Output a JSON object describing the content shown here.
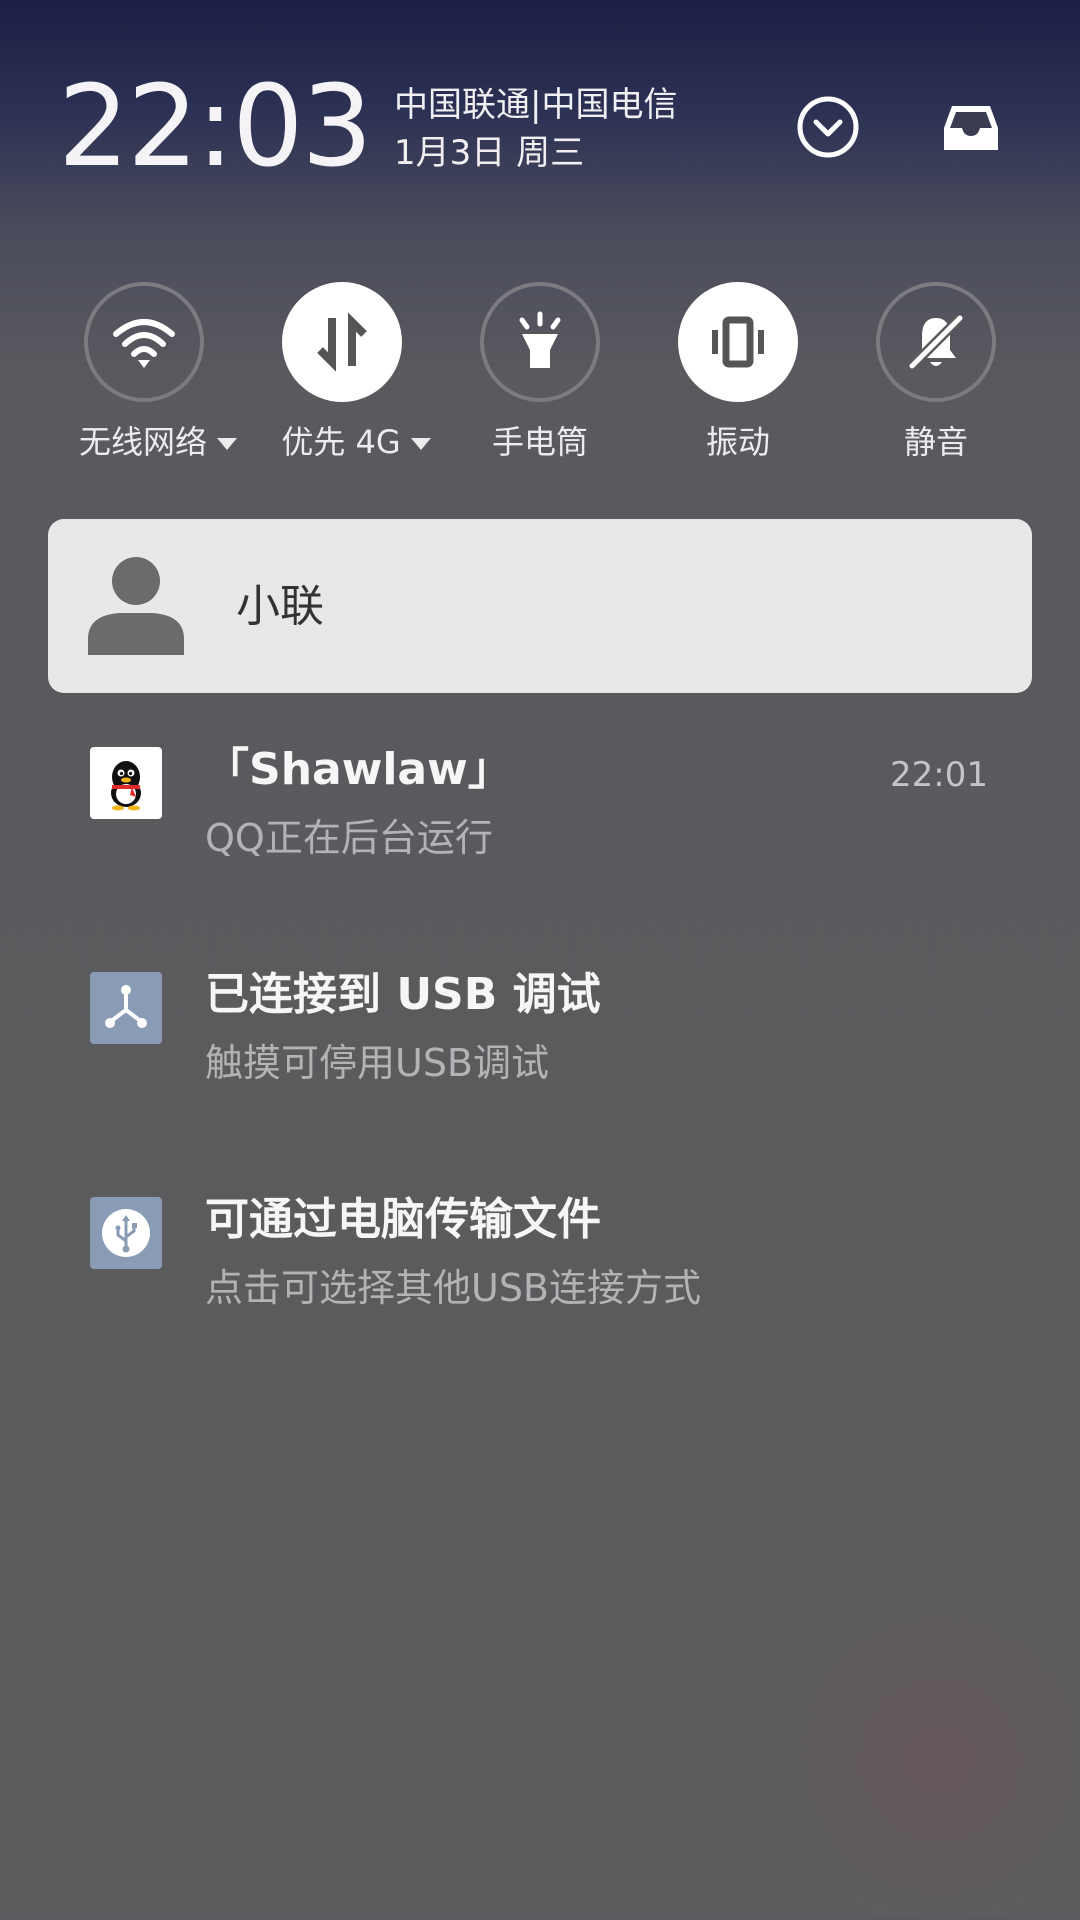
{
  "header": {
    "time": "22:03",
    "carrier": "中国联通|中国电信",
    "date": "1月3日 周三"
  },
  "quick_settings": [
    {
      "id": "wifi",
      "label": "无线网络",
      "state": "off",
      "dropdown": true,
      "icon": "wifi-icon"
    },
    {
      "id": "data",
      "label": "优先 4G",
      "state": "on",
      "dropdown": true,
      "icon": "mobile-data-icon"
    },
    {
      "id": "flashlight",
      "label": "手电筒",
      "state": "off",
      "dropdown": false,
      "icon": "flashlight-icon"
    },
    {
      "id": "vibrate",
      "label": "振动",
      "state": "on",
      "dropdown": false,
      "icon": "vibrate-icon"
    },
    {
      "id": "mute",
      "label": "静音",
      "state": "off",
      "dropdown": false,
      "icon": "bell-off-icon"
    }
  ],
  "contact": {
    "name": "小联"
  },
  "notifications": [
    {
      "icon": "qq-penguin-icon",
      "title": "「Shawlaw」",
      "text": "QQ正在后台运行",
      "time": "22:01"
    },
    {
      "icon": "usb-debug-icon",
      "title": "已连接到 USB 调试",
      "text": "触摸可停用USB调试"
    },
    {
      "icon": "usb-icon",
      "title": "可通过电脑传输文件",
      "text": "点击可选择其他USB连接方式"
    }
  ],
  "colors": {
    "background_top": "#1b1f45",
    "background": "#5c5c5e",
    "tile_on": "#ffffff",
    "tile_off_ring": "#7c7c80",
    "card": "#e8e8e8",
    "notif_icon_bg": "#8a9cb5"
  }
}
